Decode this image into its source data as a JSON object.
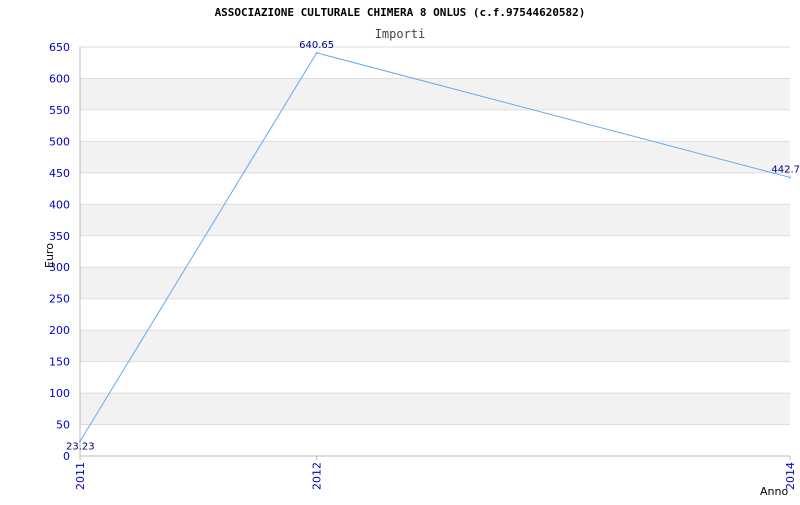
{
  "chart_data": {
    "type": "line",
    "title": "ASSOCIAZIONE CULTURALE CHIMERA 8 ONLUS (c.f.97544620582)",
    "subtitle": "Importi",
    "xlabel": "Anno",
    "ylabel": "Euro",
    "x": [
      "2011",
      "2012",
      "2014"
    ],
    "series": [
      {
        "values": [
          23.23,
          640.65,
          442.7
        ],
        "labels": [
          "23.23",
          "640.65",
          "442.7"
        ]
      }
    ],
    "ylim": [
      0,
      650
    ],
    "yticks": [
      "0",
      "50",
      "100",
      "150",
      "200",
      "250",
      "300",
      "350",
      "400",
      "450",
      "500",
      "550",
      "600",
      "650"
    ],
    "grid": true,
    "line_color": "#66aaee",
    "tick_color": "#0000cc",
    "band_color": "#f2f2f2",
    "gridline_color": "#dddddd"
  }
}
